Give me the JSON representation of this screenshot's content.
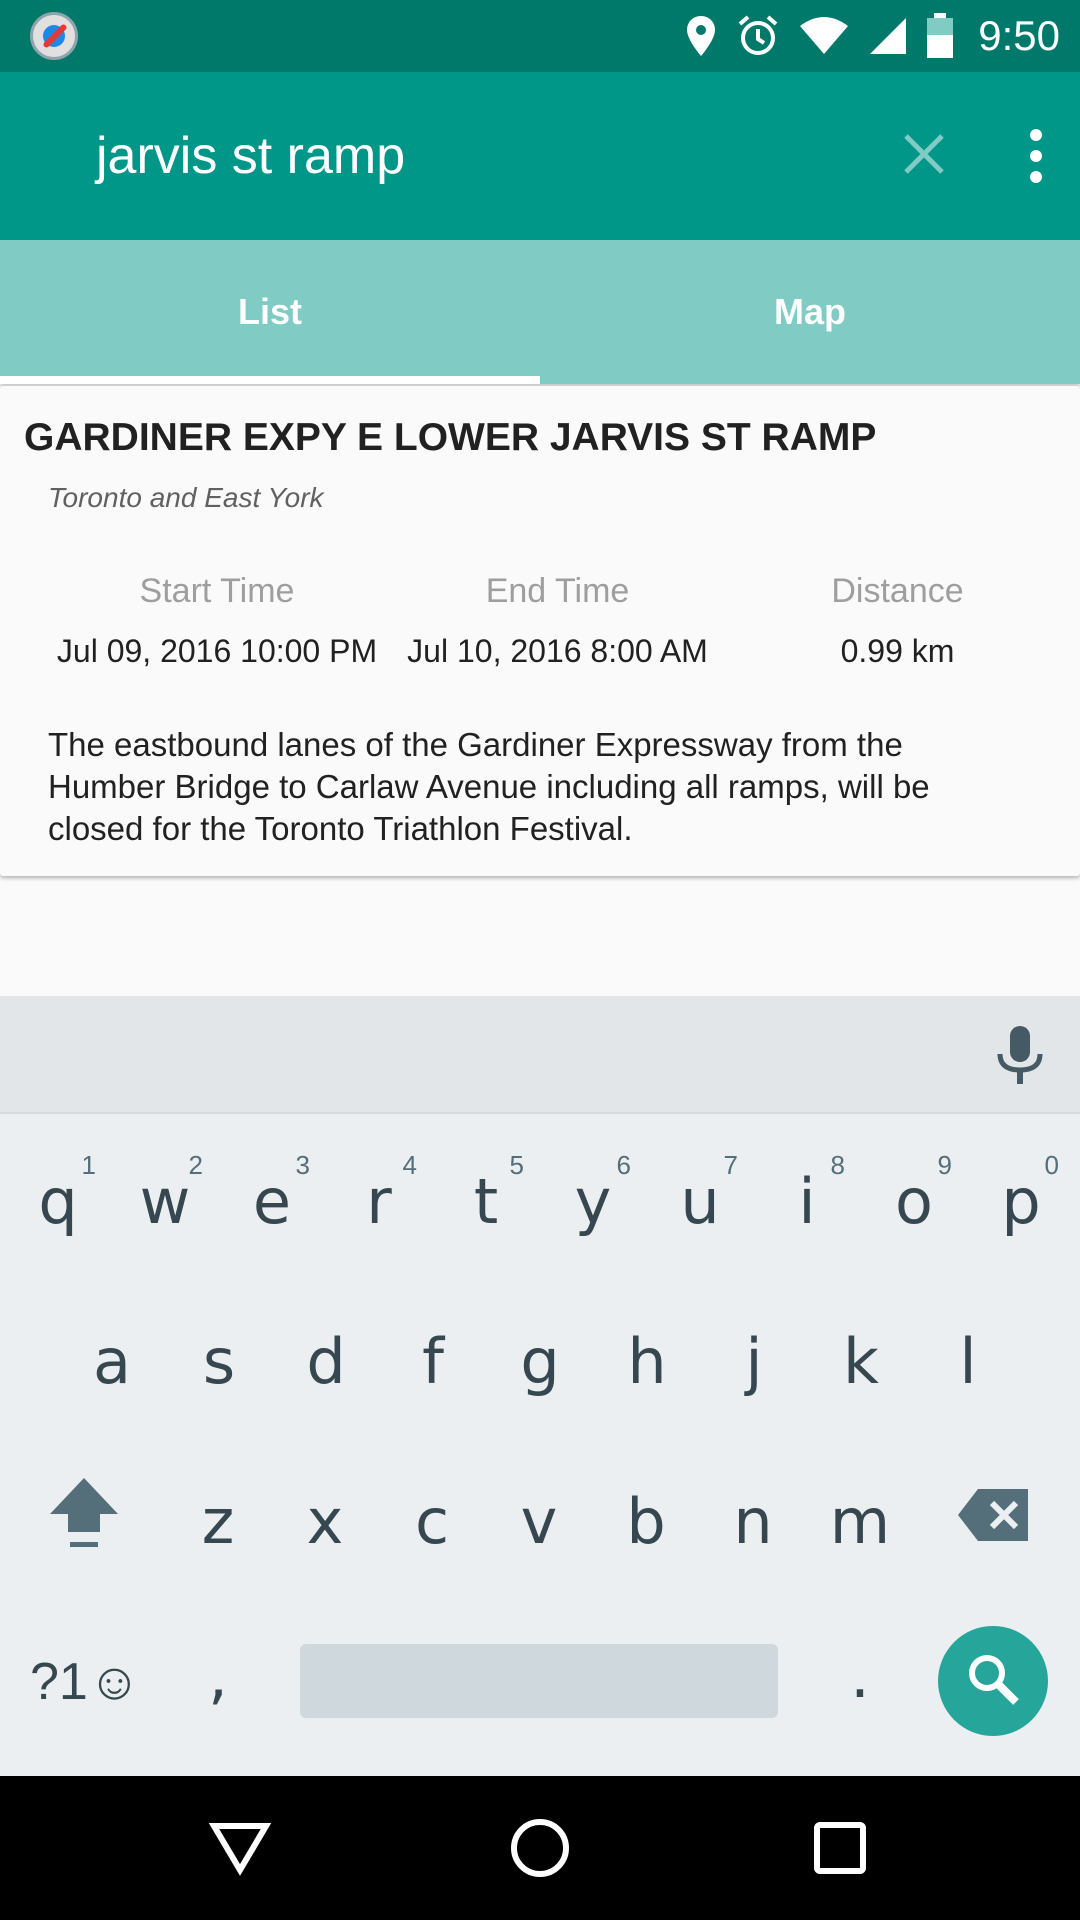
{
  "status_bar": {
    "time": "9:50",
    "icons": [
      "location-icon",
      "alarm-icon",
      "wifi-icon",
      "signal-icon",
      "battery-icon"
    ]
  },
  "app_bar": {
    "search_query": "jarvis st ramp",
    "clear_icon": "close-icon",
    "menu_icon": "more-vert-icon"
  },
  "tabs": [
    {
      "label": "List",
      "selected": true
    },
    {
      "label": "Map",
      "selected": false
    }
  ],
  "result": {
    "title": "GARDINER EXPY E LOWER JARVIS ST RAMP",
    "area": "Toronto and East York",
    "start_label": "Start Time",
    "start_value": "Jul 09, 2016 10:00 PM",
    "end_label": "End Time",
    "end_value": "Jul 10, 2016 8:00 AM",
    "distance_label": "Distance",
    "distance_value": "0.99 km",
    "description": "The eastbound lanes of the Gardiner Expressway from the Humber Bridge to Carlaw Avenue including all ramps, will be closed for the Toronto Triathlon Festival."
  },
  "keyboard": {
    "row1": [
      "q",
      "w",
      "e",
      "r",
      "t",
      "y",
      "u",
      "i",
      "o",
      "p"
    ],
    "row1_hints": [
      "1",
      "2",
      "3",
      "4",
      "5",
      "6",
      "7",
      "8",
      "9",
      "0"
    ],
    "row2": [
      "a",
      "s",
      "d",
      "f",
      "g",
      "h",
      "j",
      "k",
      "l"
    ],
    "row3": [
      "z",
      "x",
      "c",
      "v",
      "b",
      "n",
      "m"
    ],
    "symbols_label": "?1☺",
    "comma": ",",
    "period": "."
  },
  "colors": {
    "status_bar": "#00796b",
    "app_bar": "#009688",
    "tabs": "#80cbc4",
    "search_key": "#26a69a"
  }
}
